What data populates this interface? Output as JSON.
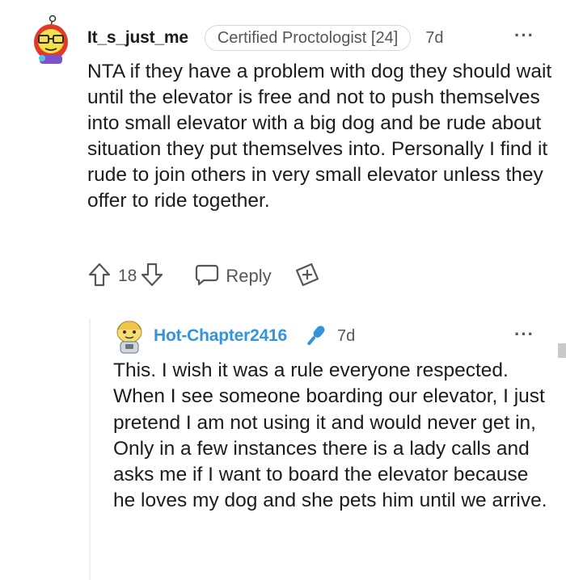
{
  "comment1": {
    "username": "It_s_just_me",
    "flair": "Certified Proctologist [24]",
    "time": "7d",
    "more_icon": "···",
    "body": "NTA if they have a problem with dog they should wait until the elevator is free and not to push themselves into small elevator with a big dog and be rude about situation they put themselves into. Personally I find it rude to join others in very small elevator unless they offer to ride together.",
    "score": "18",
    "reply_label": "Reply",
    "icons": [
      "upvote-icon",
      "downvote-icon",
      "reply-icon",
      "award-icon",
      "more-icon"
    ]
  },
  "comment2": {
    "username": "Hot-Chapter2416",
    "time": "7d",
    "more_icon": "···",
    "body": "This. I wish it was a rule everyone respected. When I see someone boarding our elevator, I just pretend I am not using it and would never get in, Only in a few instances there is a lady calls and asks me if I want to board the elevator because he loves my dog and she pets him until we arrive.",
    "icons": [
      "microphone-icon",
      "more-icon"
    ]
  },
  "colors": {
    "username_link": "#3394dc",
    "meta_text": "#545658",
    "body_text": "#1c1c1c",
    "thread_line": "#edeff1"
  }
}
